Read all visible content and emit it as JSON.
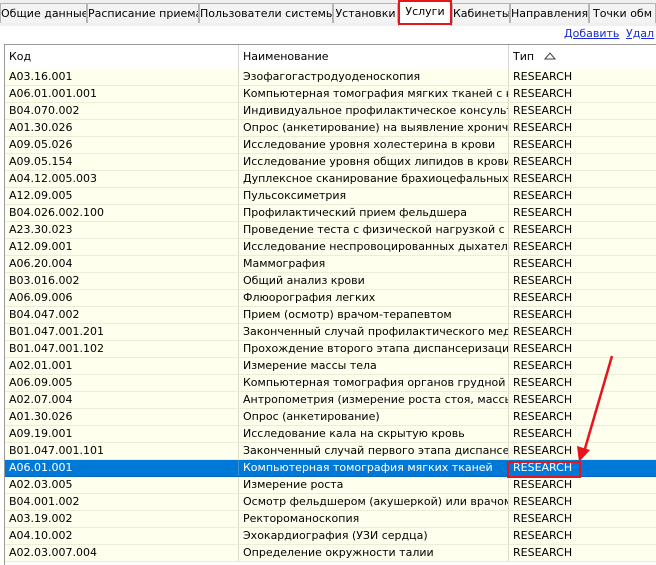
{
  "tabs": [
    {
      "label": "Общие данные",
      "active": false
    },
    {
      "label": "Расписание приема",
      "active": false
    },
    {
      "label": "Пользователи системы",
      "active": false
    },
    {
      "label": "Установки",
      "active": false
    },
    {
      "label": "Услуги",
      "active": true
    },
    {
      "label": "Кабинеты",
      "active": false
    },
    {
      "label": "Направления",
      "active": false
    },
    {
      "label": "Точки обм",
      "active": false
    }
  ],
  "toolbar": {
    "add_label": "Добавить",
    "delete_label": "Удал"
  },
  "grid": {
    "columns": [
      "Код",
      "Наименование",
      "Тип"
    ],
    "sort_column": "Тип",
    "sort_icon": "triangle-up-icon",
    "selected_index": 23,
    "rows": [
      {
        "code": "A03.16.001",
        "name": "Эзофагогастродуоденоскопия",
        "type": "RESEARCH"
      },
      {
        "code": "A06.01.001.001",
        "name": "Компьютерная томография мягких тканей с конт...",
        "type": "RESEARCH"
      },
      {
        "code": "B04.070.002",
        "name": "Индивидуальное профилактическое консультиро...",
        "type": "RESEARCH"
      },
      {
        "code": "A01.30.026",
        "name": "Опрос (анкетирование) на выявление хроническ...",
        "type": "RESEARCH"
      },
      {
        "code": "A09.05.026",
        "name": "Исследование уровня холестерина в крови",
        "type": "RESEARCH"
      },
      {
        "code": "A09.05.154",
        "name": "Исследование уровня общих липидов в крови",
        "type": "RESEARCH"
      },
      {
        "code": "A04.12.005.003",
        "name": "Дуплексное сканирование брахиоцефальных арт...",
        "type": "RESEARCH"
      },
      {
        "code": "A12.09.005",
        "name": "Пульсоксиметрия",
        "type": "RESEARCH"
      },
      {
        "code": "B04.026.002.100",
        "name": "Профилактический прием фельдшера",
        "type": "RESEARCH"
      },
      {
        "code": "A23.30.023",
        "name": "Проведение теста с физической нагрузкой с исп...",
        "type": "RESEARCH"
      },
      {
        "code": "A12.09.001",
        "name": "Исследование неспровоцированных дыхательн...",
        "type": "RESEARCH"
      },
      {
        "code": "A06.20.004",
        "name": "Маммография",
        "type": "RESEARCH"
      },
      {
        "code": "B03.016.002",
        "name": "Общий анализ крови",
        "type": "RESEARCH"
      },
      {
        "code": "A06.09.006",
        "name": "Флюорография легких",
        "type": "RESEARCH"
      },
      {
        "code": "B04.047.002",
        "name": "Прием (осмотр) врачом-терапевтом",
        "type": "RESEARCH"
      },
      {
        "code": "B01.047.001.201",
        "name": "Законченный случай профилактического медици...",
        "type": "RESEARCH"
      },
      {
        "code": "B01.047.001.102",
        "name": "Прохождение второго этапа диспансеризации в ...",
        "type": "RESEARCH"
      },
      {
        "code": "A02.01.001",
        "name": "Измерение массы тела",
        "type": "RESEARCH"
      },
      {
        "code": "A06.09.005",
        "name": "Компьютерная томография органов грудной пол...",
        "type": "RESEARCH"
      },
      {
        "code": "A02.07.004",
        "name": "Антропометрия (измерение роста стоя, массы т...",
        "type": "RESEARCH"
      },
      {
        "code": "A01.30.026",
        "name": "Опрос (анкетирование)",
        "type": "RESEARCH"
      },
      {
        "code": "A09.19.001",
        "name": "Исследование кала на скрытую кровь",
        "type": "RESEARCH"
      },
      {
        "code": "B01.047.001.101",
        "name": "Законченный случай первого этапа диспансериз...",
        "type": "RESEARCH"
      },
      {
        "code": "A06.01.001",
        "name": "Компьютерная томография мягких тканей",
        "type": "RESEARCH"
      },
      {
        "code": "A02.03.005",
        "name": "Измерение роста",
        "type": "RESEARCH"
      },
      {
        "code": "B04.001.002",
        "name": "Осмотр фельдшером (акушеркой) или врачом ак...",
        "type": "RESEARCH"
      },
      {
        "code": "A03.19.002",
        "name": "Ректороманоскопия",
        "type": "RESEARCH"
      },
      {
        "code": "A04.10.002",
        "name": "Эхокардиография (УЗИ сердца)",
        "type": "RESEARCH"
      },
      {
        "code": "A02.03.007.004",
        "name": "Определение окружности талии",
        "type": "RESEARCH"
      }
    ]
  },
  "colors": {
    "row_bg": "#ffffee",
    "selected_bg": "#0078d7",
    "annotation": "#e8141c",
    "link": "#1a2bd1"
  }
}
